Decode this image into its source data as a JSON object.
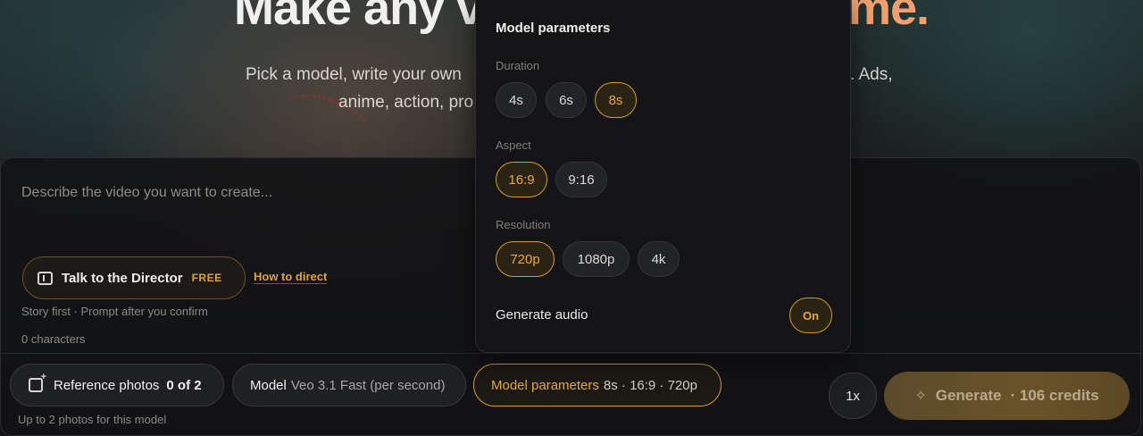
{
  "hero": {
    "title": "Make any vi",
    "title_accent": "me.",
    "subtitle_line1": "Pick a model, write your own",
    "subtitle_line1_end": ". Ads,",
    "subtitle_line2": "anime, action, pro"
  },
  "composer": {
    "placeholder": "Describe the video you want to create...",
    "director": {
      "label": "Talk to the Director",
      "tag": "FREE",
      "icon": "director-panel-icon"
    },
    "how_to_link": "How to direct",
    "director_note": "Story first · Prompt after you confirm",
    "char_count": "0 characters"
  },
  "toolbar": {
    "reference_photos": {
      "label": "Reference photos",
      "count": "0 of 2",
      "note": "Up to 2 photos for this model",
      "icon": "add-photo-icon"
    },
    "model": {
      "label": "Model",
      "value": "Veo 3.1 Fast (per second)"
    },
    "model_parameters": {
      "label": "Model parameters",
      "summary": "8s · 16:9 · 720p"
    },
    "multiplier": "1x",
    "generate": {
      "label": "Generate",
      "credits": "· 106 credits",
      "icon": "sparkle-icon"
    }
  },
  "popover": {
    "title": "Model parameters",
    "duration": {
      "label": "Duration",
      "options": [
        "4s",
        "6s",
        "8s"
      ],
      "selected": "8s"
    },
    "aspect": {
      "label": "Aspect",
      "options": [
        "16:9",
        "9:16"
      ],
      "selected": "16:9"
    },
    "resolution": {
      "label": "Resolution",
      "options": [
        "720p",
        "1080p",
        "4k"
      ],
      "selected": "720p"
    },
    "audio": {
      "label": "Generate audio",
      "state": "On"
    }
  },
  "colors": {
    "accent": "#e7a93c",
    "accent_border": "#d79a2b",
    "hero_accent": "#f0a070",
    "panel_bg": "#141416"
  }
}
